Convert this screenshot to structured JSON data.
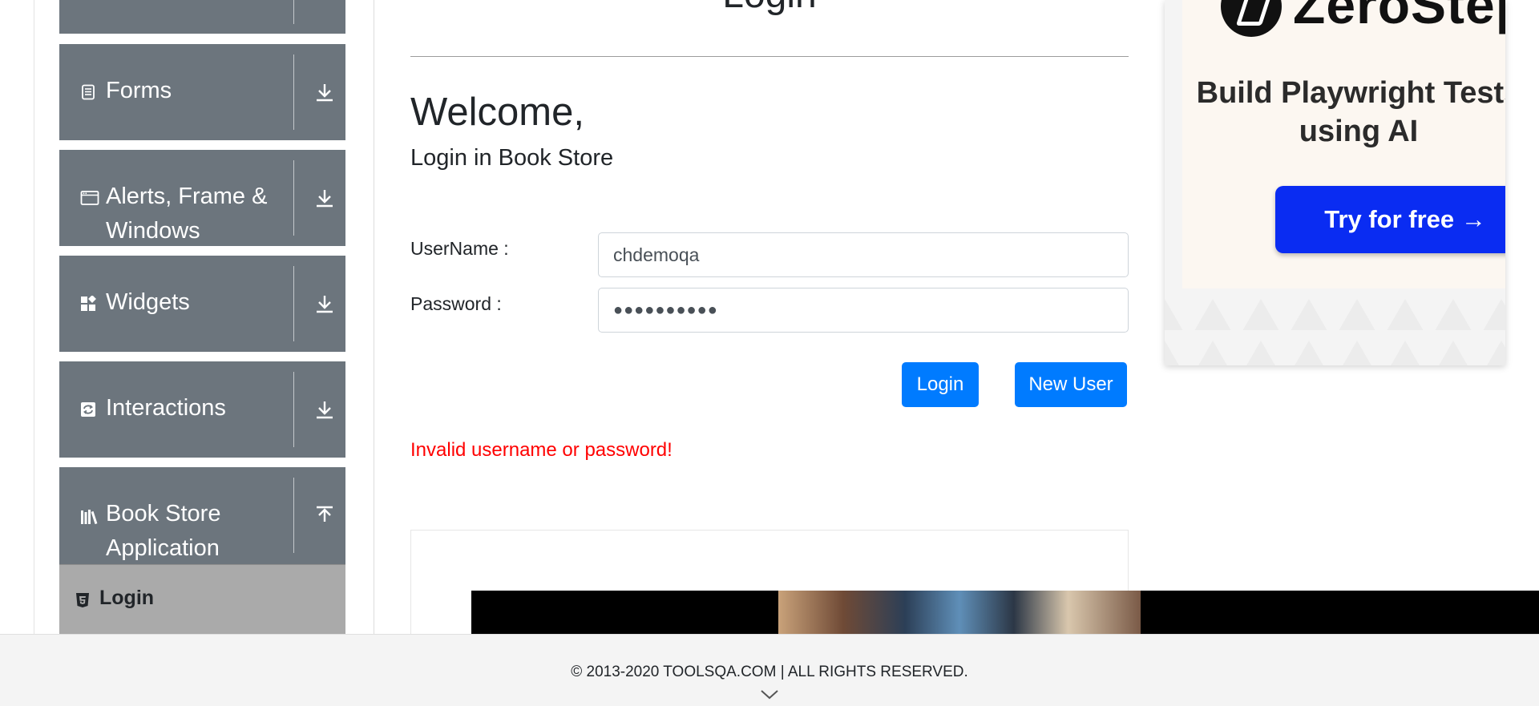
{
  "sidebar": {
    "groups": [
      {
        "label": "Forms",
        "icon": "forms-icon"
      },
      {
        "label": "Alerts, Frame & Windows",
        "icon": "window-icon"
      },
      {
        "label": "Widgets",
        "icon": "widgets-icon"
      },
      {
        "label": "Interactions",
        "icon": "interactions-icon"
      },
      {
        "label": "Book Store Application",
        "icon": "book-store-icon"
      }
    ],
    "active_item": {
      "label": "Login",
      "icon": "html5-icon"
    }
  },
  "main": {
    "page_title": "Login",
    "welcome": "Welcome,",
    "subtitle": "Login in Book Store",
    "username_label": "UserName :",
    "username_value": "chdemoqa",
    "password_label": "Password :",
    "password_value": "●●●●●●●●●●",
    "login_button": "Login",
    "new_user_button": "New User",
    "error_message": "Invalid username or password!"
  },
  "ad": {
    "brand": "ZeroStep",
    "headline": "Build Playwright Tests using AI",
    "cta": "Try for free →",
    "cta_color": "#0a2cf2"
  },
  "footer": {
    "copyright": "© 2013-2020 TOOLSQA.COM | ALL RIGHTS RESERVED."
  },
  "colors": {
    "sidebar_group": "#6c757d",
    "active_item": "#aaaaaa",
    "primary_button": "#007bff",
    "error": "#ff0000"
  }
}
